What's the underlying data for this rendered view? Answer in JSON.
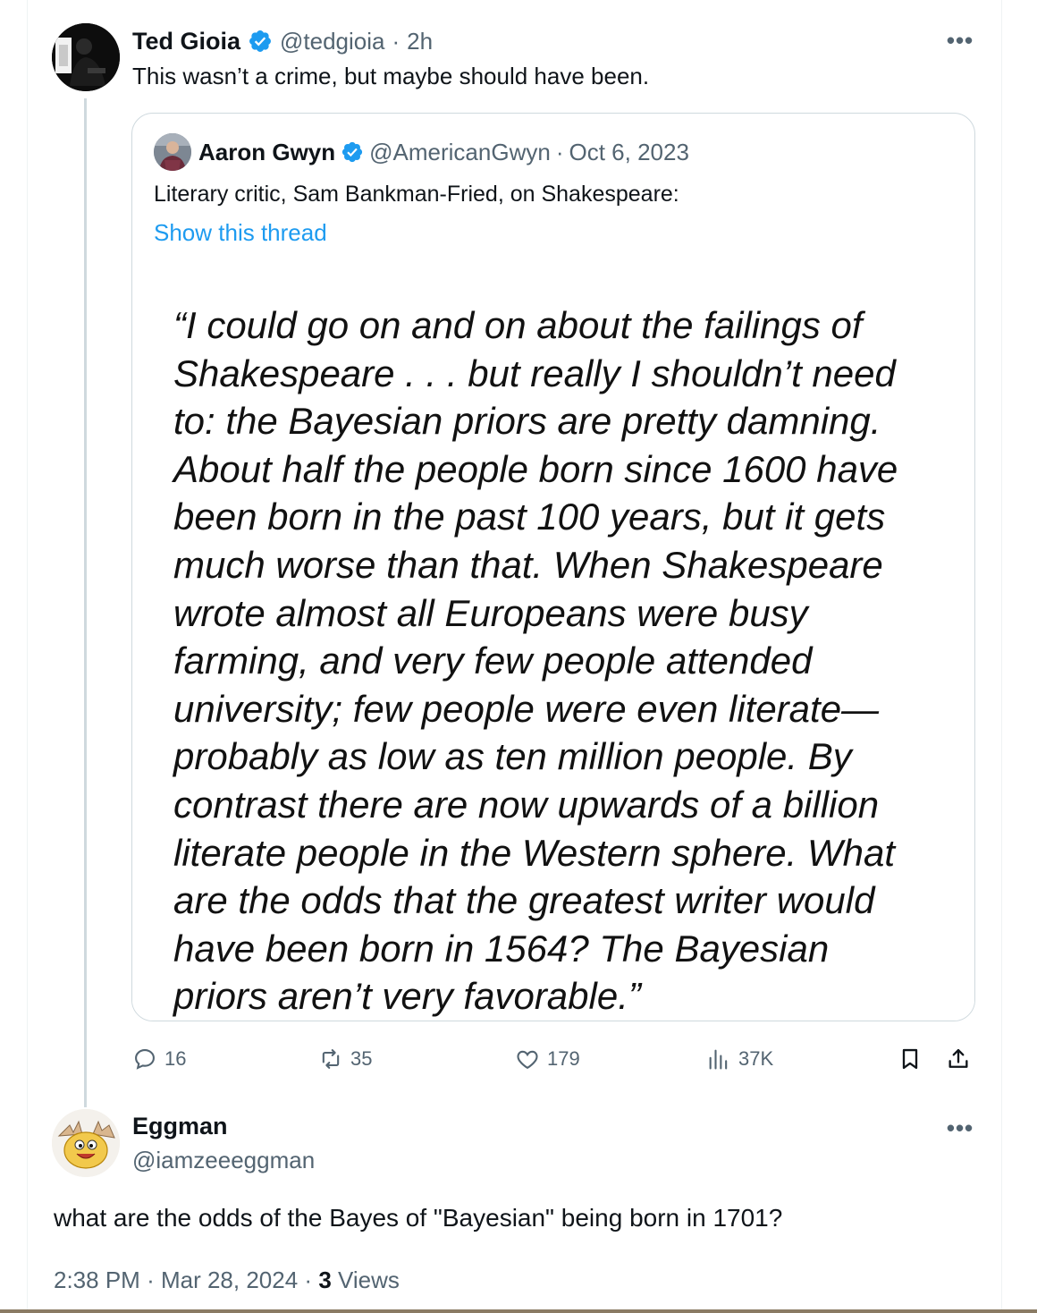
{
  "main_tweet": {
    "author_name": "Ted Gioia",
    "handle": "@tedgioia",
    "separator": "·",
    "time": "2h",
    "text": "This wasn’t a crime, but maybe should have been.",
    "more_icon": "more-horizontal-icon"
  },
  "quoted_tweet": {
    "author_name": "Aaron Gwyn",
    "handle": "@AmericanGwyn",
    "separator": "·",
    "date": "Oct 6, 2023",
    "text": "Literary critic, Sam Bankman-Fried, on Shakespeare:",
    "show_thread_label": "Show this thread",
    "image_quote_lines": [
      "“I could go on and on about the failings of",
      "Shakespeare . . . but really I shouldn’t need",
      "to: the Bayesian priors are pretty damning.",
      "About half the people born since 1600 have",
      "been born in the past 100 years, but it gets",
      "much worse than that. When Shakespeare",
      "wrote almost all Europeans were busy",
      "farming, and very few people attended",
      "university; few people were even literate—",
      "probably as low as ten million people. By",
      "contrast there are now upwards of a billion",
      "literate people in the Western sphere. What",
      "are the odds that the greatest writer would",
      "have been born in 1564? The Bayesian",
      "priors aren’t very favorable.”"
    ]
  },
  "actions": {
    "reply_count": "16",
    "retweet_count": "35",
    "like_count": "179",
    "views_count": "37K"
  },
  "reply": {
    "author_name": "Eggman",
    "handle": "@iamzeeeggman",
    "text": "what are the odds of the Bayes of \"Bayesian\" being born in 1701?",
    "time": "2:38 PM",
    "separator": "·",
    "date": "Mar 28, 2024",
    "separator2": "·",
    "views_count": "3",
    "views_label": "Views"
  },
  "colors": {
    "accent": "#1d9bf0",
    "muted": "#536471",
    "text": "#0f1419",
    "border": "#cfd9de"
  }
}
